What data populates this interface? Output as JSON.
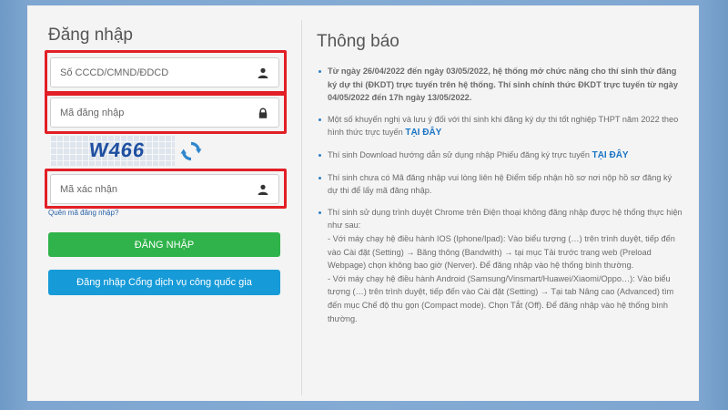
{
  "login": {
    "title": "Đăng nhập",
    "id_placeholder": "Số CCCD/CMND/ĐDCD",
    "password_placeholder": "Mã đăng nhập",
    "captcha_image_text": "W466",
    "captcha_placeholder": "Mã xác nhận",
    "forgot_link": "Quên mã đăng nhập?",
    "login_button": "ĐĂNG NHẬP",
    "portal_button": "Đăng nhập Cổng dịch vụ công quốc gia"
  },
  "notices": {
    "title": "Thông báo",
    "items": [
      {
        "text": "Từ ngày 26/04/2022 đến ngày 03/05/2022, hệ thống mở chức năng cho thí sinh thử đăng ký dự thi (ĐKDT) trực tuyến trên hệ thống. Thí sinh chính thức ĐKDT trực tuyến từ ngày 04/05/2022 đến 17h ngày 13/05/2022."
      },
      {
        "text": "Một số khuyến nghị và lưu ý đối với thí sinh khi đăng ký dự thi tốt nghiệp THPT năm 2022 theo hình thức trực tuyến",
        "link": "TẠI ĐÂY"
      },
      {
        "text": "Thí sinh Download hướng dẫn sử dụng nhập Phiếu đăng ký trực tuyến",
        "link": "TẠI ĐÂY"
      },
      {
        "text": "Thí sinh chưa có Mã đăng nhập vui lòng liên hệ Điểm tiếp nhận hồ sơ nơi nộp hồ sơ đăng ký dự thi để lấy mã đăng nhập."
      },
      {
        "text": "Thí sinh sử dụng trình duyệt Chrome trên Điện thoại không đăng nhập được hệ thống thực hiện như sau:",
        "sub1": " - Với máy chạy hệ điều hành IOS (Iphone/Ipad): Vào biểu tượng (…) trên trình duyệt, tiếp đến vào Cài đặt (Setting) → Băng thông (Bandwith) → tại mục Tải trước trang web (Preload Webpage) chọn không bao giờ (Nerver). Để đăng nhập vào hệ thống bình thường.",
        "sub2": " - Với máy chạy hệ điều hành Android (Samsung/Vinsmart/Huawei/Xiaomi/Oppo…): Vào biểu tượng (…) trên trình duyệt, tiếp đến vào Cài đặt (Setting) → Tại tab Nâng cao (Advanced) tìm đến mục Chế độ thu gọn (Compact mode). Chọn Tắt (Off). Để đăng nhập vào hệ thống bình thường."
      }
    ]
  },
  "colors": {
    "highlight_border": "#e21f26",
    "login_button": "#2fb34a",
    "portal_button": "#169ad8",
    "link": "#1a74c4"
  },
  "icons": {
    "id_field": "user-icon",
    "password_field": "lock-icon",
    "captcha_field": "user-icon",
    "captcha_refresh": "refresh-icon"
  }
}
